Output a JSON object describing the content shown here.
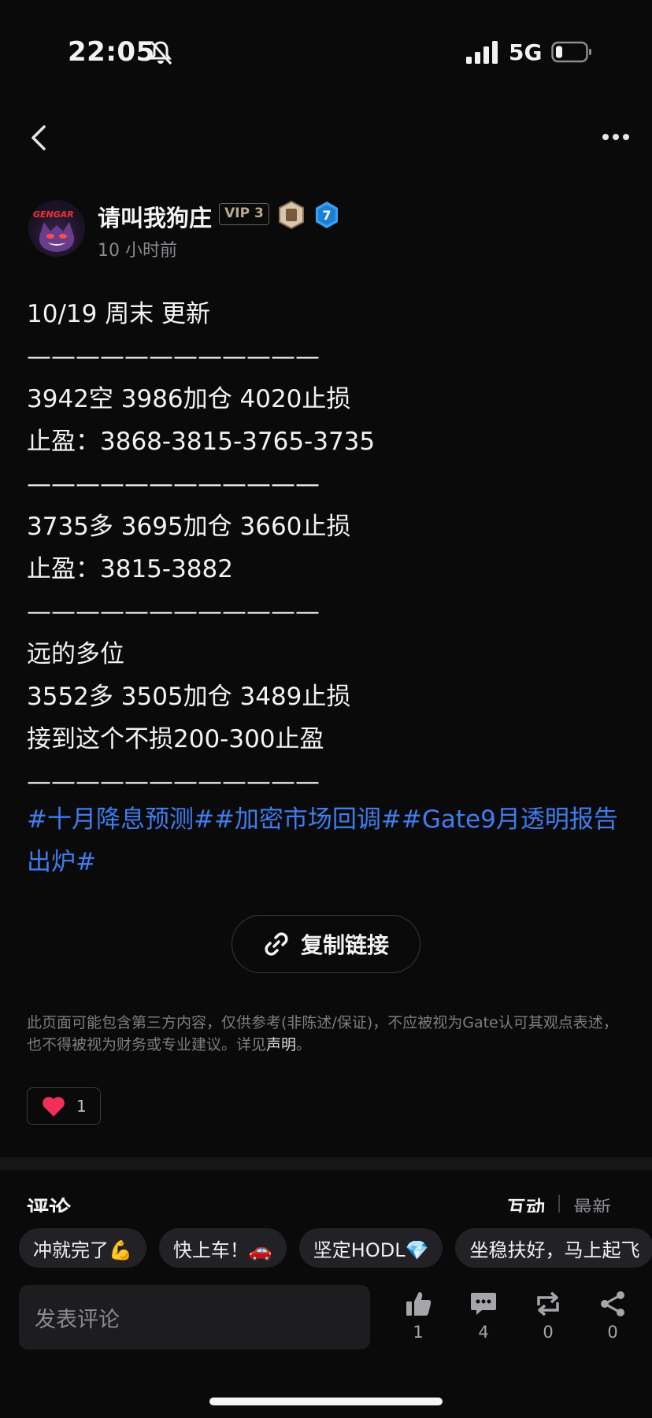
{
  "status_bar": {
    "time": "22:05",
    "network": "5G",
    "bell_icon": "bell-slash-icon",
    "signal_icon": "cellular-signal-icon",
    "battery_icon": "battery-icon"
  },
  "nav": {
    "back_icon": "chevron-left-icon",
    "more_icon": "more-horizontal-icon"
  },
  "author": {
    "avatar_text": "GENGAR",
    "name": "请叫我狗庄",
    "vip": "VIP 3",
    "level": "7",
    "time_ago": "10 小时前"
  },
  "post": {
    "lines": [
      "10/19 周末 更新",
      "————————————",
      "3942空 3986加仓 4020止损",
      "止盈：3868-3815-3765-3735",
      "————————————",
      "3735多 3695加仓 3660止损",
      "止盈：3815-3882",
      "————————————",
      "远的多位",
      "3552多 3505加仓 3489止损",
      "接到这个不损200-300止盈",
      "————————————"
    ],
    "hashtags": "#十月降息预测##加密市场回调##Gate9月透明报告出炉#"
  },
  "copy_link": {
    "label": "复制链接",
    "icon": "link-icon"
  },
  "disclaimer": {
    "text": "此页面可能包含第三方内容，仅供参考(非陈述/保证)，不应被视为Gate认可其观点表述，也不得被视为财务或专业建议。详见",
    "link": "声明",
    "end": "。"
  },
  "reaction": {
    "icon": "heart-icon",
    "count": "1",
    "color": "#f0305a"
  },
  "comments": {
    "title": "评论",
    "sort_active": "互动",
    "sort_inactive": "最新",
    "quick_replies": [
      "冲就完了💪",
      "快上车！🚗",
      "坚定HODL💎",
      "坐稳扶好，马上起飞"
    ],
    "input_placeholder": "发表评论"
  },
  "actions": [
    {
      "icon": "thumbs-up-icon",
      "count": "1"
    },
    {
      "icon": "comment-icon",
      "count": "4"
    },
    {
      "icon": "repost-icon",
      "count": "0"
    },
    {
      "icon": "share-icon",
      "count": "0"
    }
  ],
  "colors": {
    "background": "#0a0a0b",
    "hashtag": "#3f7df0",
    "text": "#f3f3f3",
    "muted": "#8a8a8f"
  }
}
